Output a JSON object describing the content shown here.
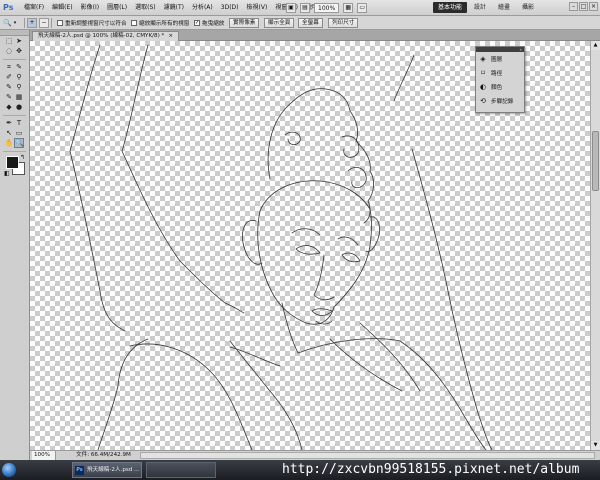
{
  "app": {
    "logo": "Ps",
    "menu": [
      "檔案(F)",
      "編輯(E)",
      "影像(I)",
      "圖層(L)",
      "選取(S)",
      "濾鏡(T)",
      "分析(A)",
      "3D(D)",
      "檢視(V)",
      "視窗(W)",
      "說明(H)"
    ],
    "zoom_value": "100%",
    "workspaces": [
      "基本功能",
      "設計",
      "繪畫",
      "攝影"
    ],
    "active_workspace_index": 0
  },
  "options_bar": {
    "resize_windows_label": "重新調整視窗尺寸以符合",
    "resize_windows_checked": false,
    "zoom_all_windows_label": "縮放顯示所有的視窗",
    "zoom_all_windows_checked": false,
    "scrubby_zoom_label": "拖曳縮放",
    "scrubby_zoom_checked": true,
    "buttons": [
      "實際像素",
      "顯示全頁",
      "全螢幕",
      "列印尺寸"
    ]
  },
  "document": {
    "tab_title": "飛天線稿-2人.psd @ 100% (線稿-02, CMYK/8) *",
    "close_label": "×"
  },
  "tools": {
    "rows": [
      [
        "⬚",
        "➤"
      ],
      [
        "◌",
        "✥"
      ],
      [
        "⌗",
        "✎"
      ],
      [
        "✐",
        "⚲"
      ],
      [
        "✎",
        "⚲"
      ],
      [
        "✎",
        "▦"
      ],
      [
        "◆",
        "●"
      ],
      [
        "✒",
        "T"
      ],
      [
        "↖",
        "▭"
      ],
      [
        "✋",
        "🔍"
      ]
    ],
    "row_names": [
      [
        "marquee-tool",
        "move-tool"
      ],
      [
        "lasso-tool",
        "quick-selection-tool"
      ],
      [
        "crop-tool",
        "eyedropper-tool"
      ],
      [
        "healing-brush-tool",
        "brush-tool"
      ],
      [
        "clone-stamp-tool",
        "history-brush-tool"
      ],
      [
        "eraser-tool",
        "gradient-tool"
      ],
      [
        "blur-tool",
        "dodge-tool"
      ],
      [
        "pen-tool",
        "type-tool"
      ],
      [
        "path-selection-tool",
        "rectangle-tool"
      ],
      [
        "hand-tool",
        "zoom-tool"
      ]
    ],
    "active_tool": "zoom-tool",
    "foreground_color": "#1a1a1a",
    "background_color": "#ffffff"
  },
  "panel": {
    "items": [
      {
        "icon": "layers-icon",
        "glyph": "◈",
        "label": "圖層"
      },
      {
        "icon": "paths-icon",
        "glyph": "⌑",
        "label": "路徑"
      },
      {
        "icon": "color-icon",
        "glyph": "◐",
        "label": "顏色"
      },
      {
        "icon": "history-icon",
        "glyph": "⟲",
        "label": "步驟記錄"
      }
    ]
  },
  "status": {
    "zoom": "100%",
    "doc_size": "文件: 66.4M/242.9M"
  },
  "taskbar": {
    "ps_task_label": "飛天線稿-2人.psd ..."
  },
  "watermark": "http://zxcvbn99518155.pixnet.net/album"
}
